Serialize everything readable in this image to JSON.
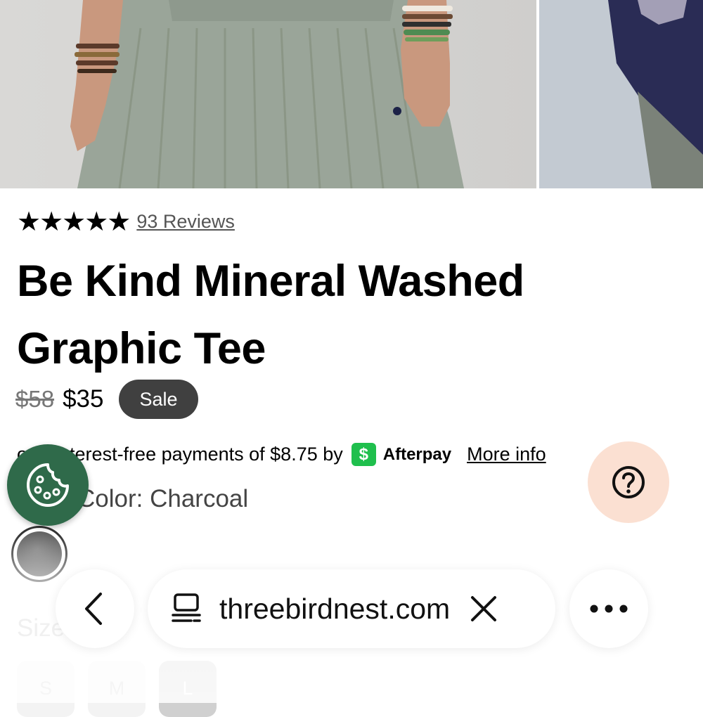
{
  "product": {
    "rating_stars": "★★★★★",
    "rating_value": 5,
    "reviews_label": "93 Reviews",
    "title": "Be Kind Mineral Washed Graphic Tee",
    "original_price": "$58",
    "sale_price": "$35",
    "sale_badge": "Sale",
    "afterpay_text": "or 4 interest-free payments of $8.75 by",
    "afterpay_logo_glyph": "$",
    "afterpay_name": "Afterpay",
    "more_info_label": "More info",
    "color_label": "Color: Charcoal",
    "swatch_color": "#5a5a5a",
    "size_label": "Size",
    "sizes": [
      "S",
      "M",
      "L"
    ],
    "selected_size": "L"
  },
  "browser": {
    "url": "threebirdnest.com",
    "back_icon": "chevron-left-icon",
    "more_icon": "ellipsis-icon"
  },
  "widgets": {
    "cookie_icon": "cookie-icon",
    "help_icon": "question-mark-icon",
    "cookie_bg": "#2f6a4a",
    "help_bg": "#fbe0d2"
  }
}
